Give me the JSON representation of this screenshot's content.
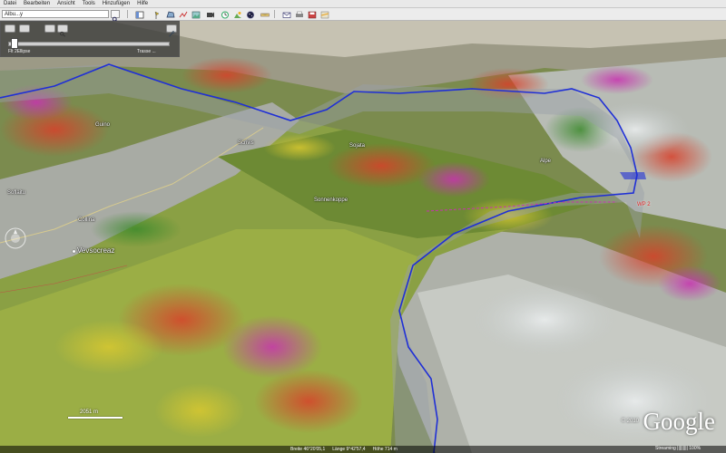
{
  "menubar": {
    "items": [
      "Datei",
      "Bearbeiten",
      "Ansicht",
      "Tools",
      "Hinzufügen",
      "Hilfe"
    ]
  },
  "toolbar": {
    "search_value": "Albu...y",
    "buttons": [
      "sidebar-toggle-icon",
      "placemark-icon",
      "polygon-icon",
      "path-icon",
      "image-overlay-icon",
      "tour-icon",
      "history-icon",
      "sun-icon",
      "sky-icon",
      "email-icon",
      "print-icon",
      "save-image-icon",
      "maps-icon"
    ]
  },
  "sidepanel": {
    "left_label": "Flt 2Ellipse",
    "right_label": "Trasse ..."
  },
  "places": [
    {
      "label": "Vevsocreaz",
      "big": true
    },
    {
      "label": "Collina"
    },
    {
      "label": "Soflaitu"
    },
    {
      "label": "Scrivis"
    },
    {
      "label": "Sonnenkoppe"
    },
    {
      "label": "Alpe"
    },
    {
      "label": "WP 2"
    },
    {
      "label": "Sojata"
    },
    {
      "label": "Guino"
    }
  ],
  "scale": "2051 m",
  "logo": "Google",
  "copyright": "© 2010",
  "status": {
    "breite": "Breite 46°20'05,1",
    "laenge": "Länge 9°42'57,4",
    "hoehe": "Höhe 714 m",
    "streaming": "Streaming ||||||||| 100%"
  },
  "colors": {
    "route": "#1f2fd6",
    "toolbar": "#ececec",
    "curtain": "#9aa0a8"
  }
}
